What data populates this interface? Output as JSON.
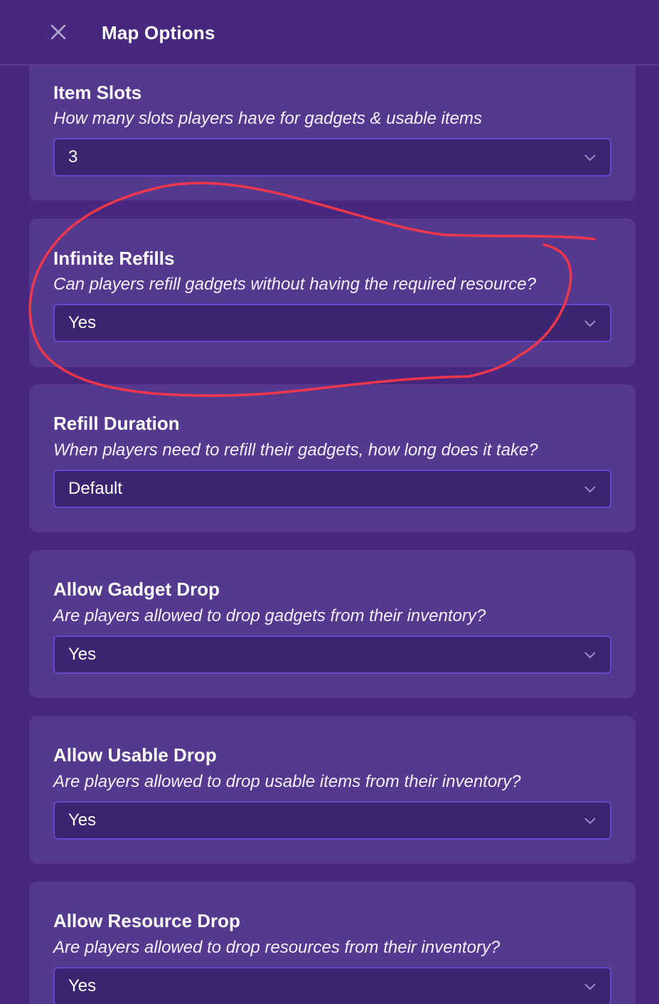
{
  "header": {
    "title": "Map Options",
    "close_icon": "close-icon"
  },
  "colors": {
    "background": "#48287f",
    "card": "#55398e",
    "select_bg": "#3c2570",
    "select_border": "#6b45c9",
    "annotation": "#f0364b"
  },
  "options": [
    {
      "title": "Item Slots",
      "description": "How many slots players have for gadgets & usable items",
      "value": "3"
    },
    {
      "title": "Infinite Refills",
      "description": "Can players refill gadgets without having the required resource?",
      "value": "Yes"
    },
    {
      "title": "Refill Duration",
      "description": "When players need to refill their gadgets, how long does it take?",
      "value": "Default"
    },
    {
      "title": "Allow Gadget Drop",
      "description": "Are players allowed to drop gadgets from their inventory?",
      "value": "Yes"
    },
    {
      "title": "Allow Usable Drop",
      "description": "Are players allowed to drop usable items from their inventory?",
      "value": "Yes"
    },
    {
      "title": "Allow Resource Drop",
      "description": "Are players allowed to drop resources from their inventory?",
      "value": "Yes"
    }
  ]
}
